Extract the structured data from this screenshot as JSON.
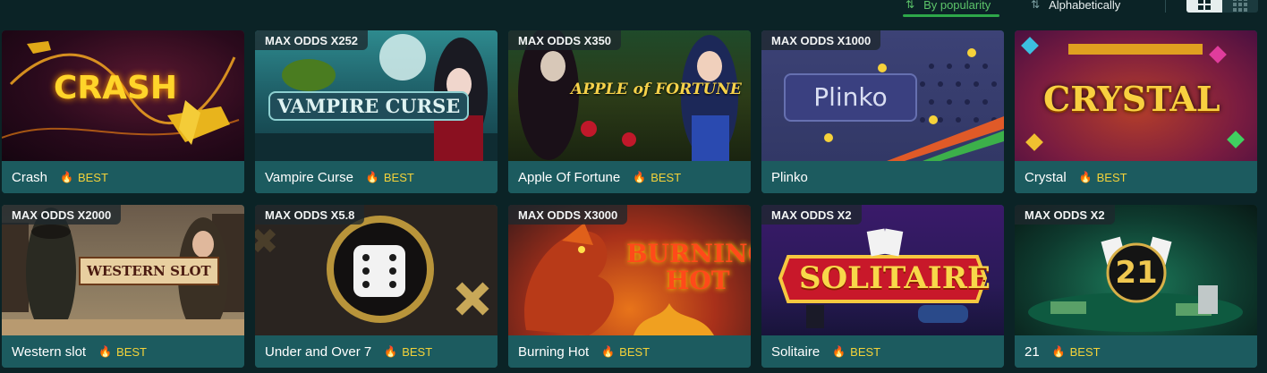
{
  "sort": {
    "popularity_label": "By popularity",
    "alphabetical_label": "Alphabetically"
  },
  "games": [
    {
      "name": "Crash",
      "odds": "",
      "best": "BEST"
    },
    {
      "name": "Vampire Curse",
      "odds": "MAX ODDS X252",
      "best": "BEST"
    },
    {
      "name": "Apple Of Fortune",
      "odds": "MAX ODDS X350",
      "best": "BEST"
    },
    {
      "name": "Plinko",
      "odds": "MAX ODDS X1000",
      "best": ""
    },
    {
      "name": "Crystal",
      "odds": "",
      "best": "BEST"
    },
    {
      "name": "Western slot",
      "odds": "MAX ODDS X2000",
      "best": "BEST"
    },
    {
      "name": "Under and Over 7",
      "odds": "MAX ODDS X5.8",
      "best": "BEST"
    },
    {
      "name": "Burning Hot",
      "odds": "MAX ODDS X3000",
      "best": "BEST"
    },
    {
      "name": "Solitaire",
      "odds": "MAX ODDS X2",
      "best": "BEST"
    },
    {
      "name": "21",
      "odds": "MAX ODDS X2",
      "best": "BEST"
    }
  ],
  "logos": {
    "crash": "CRASH",
    "vampire": "VAMPIRE CURSE",
    "apple": "APPLE of FORTUNE",
    "plinko": "Plinko",
    "crystal": "CRYSTAL",
    "western": "WESTERN SLOT",
    "burning1": "BURNING",
    "burning2": "HOT",
    "solitaire": "SOLITAIRE",
    "twentyone": "21"
  },
  "colors": {
    "background": "#0b2326",
    "card_footer": "#1c5b5f",
    "best": "#f3d23a",
    "active_sort": "#2ea84a"
  }
}
